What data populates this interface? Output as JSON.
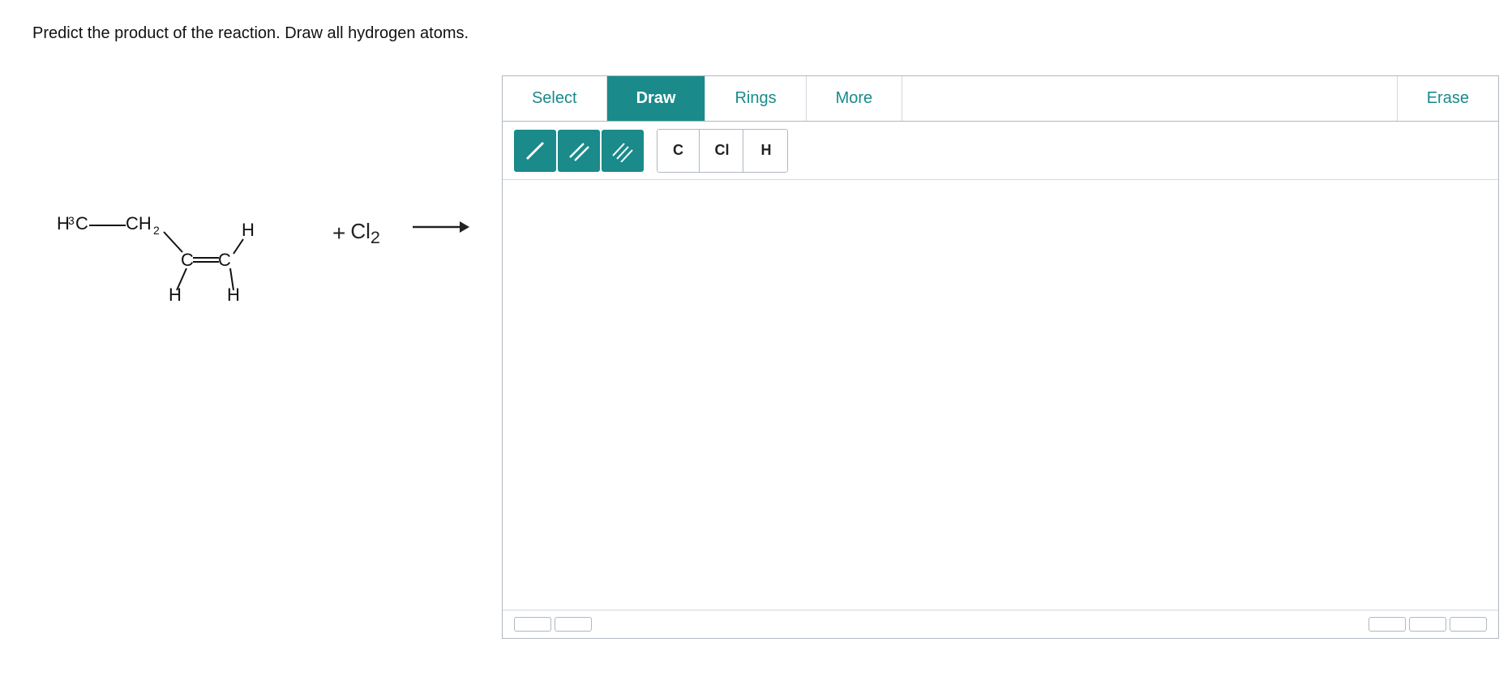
{
  "instructions": "Predict the product of the reaction. Draw all hydrogen atoms.",
  "toolbar": {
    "tabs": [
      {
        "label": "Select",
        "active": false
      },
      {
        "label": "Draw",
        "active": true
      },
      {
        "label": "Rings",
        "active": false
      },
      {
        "label": "More",
        "active": false
      },
      {
        "label": "Erase",
        "active": false,
        "erase": true
      }
    ],
    "bonds": [
      {
        "label": "single-bond",
        "lines": 1
      },
      {
        "label": "double-bond",
        "lines": 2
      },
      {
        "label": "triple-bond",
        "lines": 3
      }
    ],
    "atoms": [
      {
        "label": "C"
      },
      {
        "label": "Cl"
      },
      {
        "label": "H"
      }
    ]
  },
  "reagents": {
    "plus": "+",
    "reagent": "Cl₂",
    "arrow": "→"
  },
  "bottom_buttons": {
    "left": [
      "",
      ""
    ],
    "right": [
      "",
      "",
      ""
    ]
  }
}
